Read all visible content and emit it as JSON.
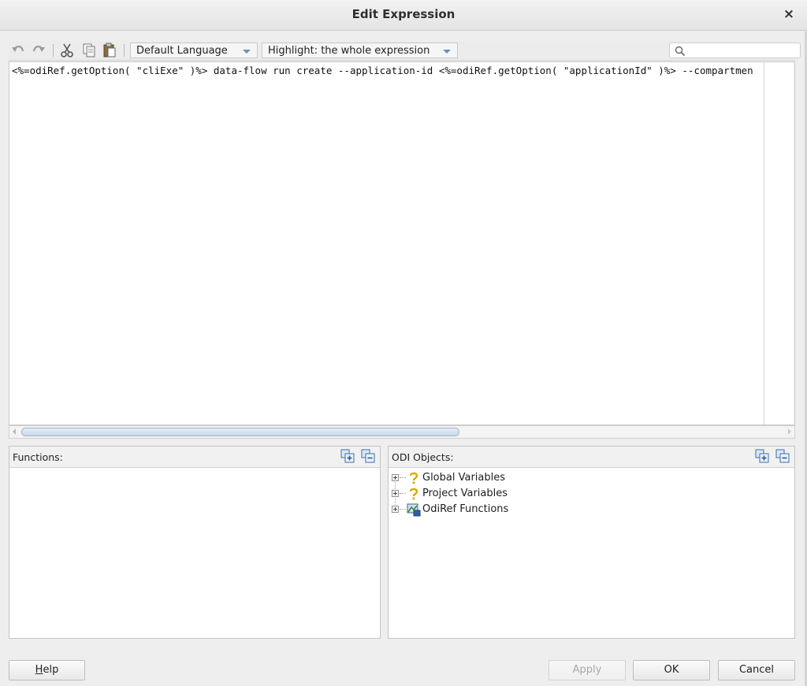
{
  "dialog": {
    "title": "Edit Expression",
    "close_glyph": "×"
  },
  "toolbar": {
    "icons": [
      "undo-icon",
      "redo-icon",
      "cut-icon",
      "copy-icon",
      "paste-icon",
      "search-icon"
    ],
    "language_combo": "Default Language",
    "highlight_combo": "Highlight: the whole expression",
    "search_value": ""
  },
  "editor": {
    "code": "<%=odiRef.getOption( \"cliExe\" )%> data-flow run create --application-id <%=odiRef.getOption( \"applicationId\" )%> --compartmen"
  },
  "functions_panel": {
    "title": "Functions:",
    "icons": [
      "expand-all-icon",
      "collapse-all-icon"
    ]
  },
  "odi_panel": {
    "title": "ODI Objects:",
    "icons": [
      "expand-all-icon",
      "collapse-all-icon"
    ],
    "items": [
      {
        "label": "Global Variables",
        "icon": "variable-icon"
      },
      {
        "label": "Project Variables",
        "icon": "variable-icon"
      },
      {
        "label": "OdiRef Functions",
        "icon": "function-library-icon"
      }
    ]
  },
  "buttons": {
    "help_mnemonic": "H",
    "help_rest": "elp",
    "apply": "Apply",
    "ok": "OK",
    "cancel": "Cancel"
  },
  "colors": {
    "scroll_thumb": "#c7d7e9",
    "combo_arrow": "#6d8fb4",
    "variable_icon": "#e0b400"
  }
}
